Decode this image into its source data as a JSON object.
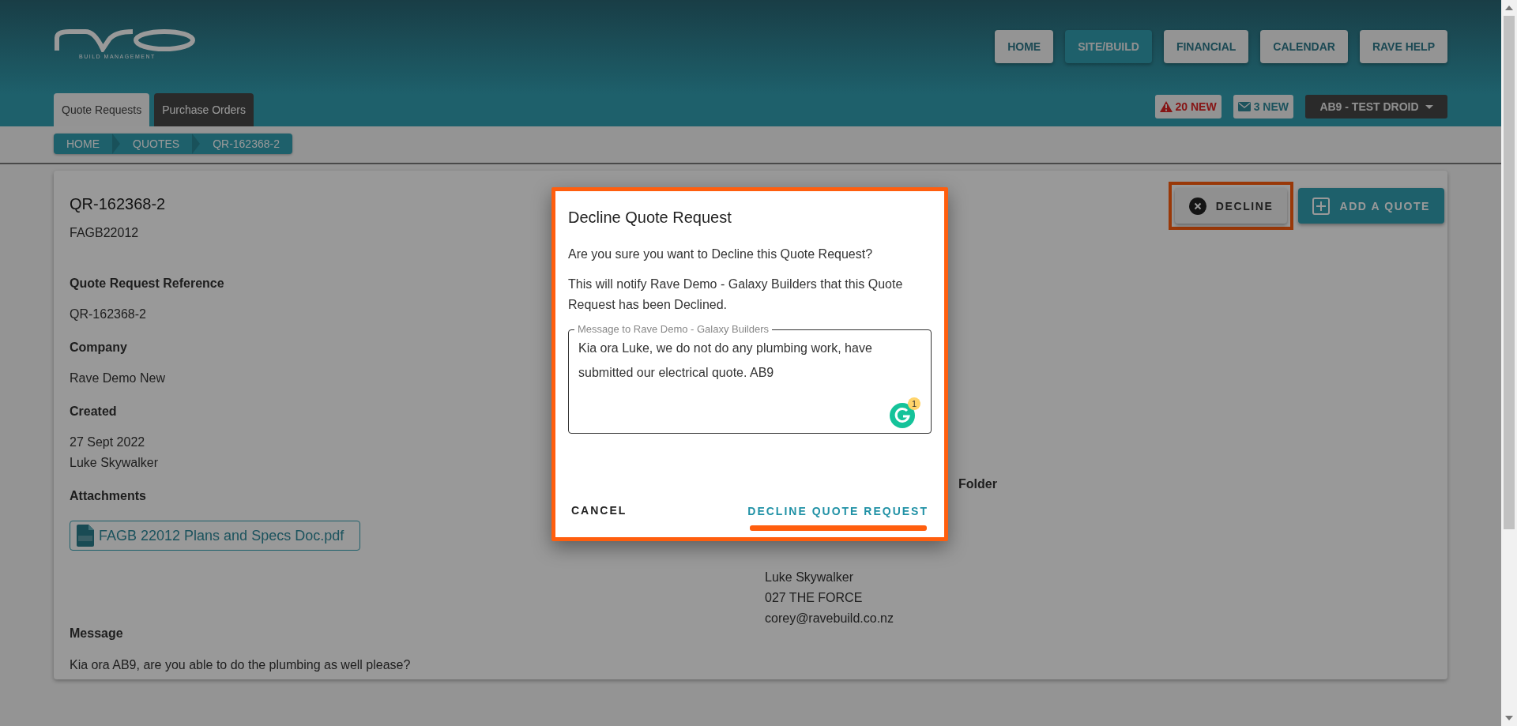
{
  "header": {
    "logo_tagline": "BUILD MANAGEMENT",
    "nav": [
      {
        "label": "HOME",
        "selected": false
      },
      {
        "label": "SITE/BUILD",
        "selected": true
      },
      {
        "label": "FINANCIAL",
        "selected": false
      },
      {
        "label": "CALENDAR",
        "selected": false
      },
      {
        "label": "RAVE HELP",
        "selected": false
      }
    ],
    "tabs": [
      {
        "label": "Quote Requests",
        "selected": true
      },
      {
        "label": "Purchase Orders",
        "selected": false
      }
    ],
    "alerts": [
      {
        "kind": "warning",
        "label": "20 NEW"
      },
      {
        "kind": "mail",
        "label": "3 NEW"
      }
    ],
    "user_menu": "AB9 - TEST DROID"
  },
  "breadcrumb": [
    "HOME",
    "QUOTES",
    "QR-162368-2"
  ],
  "quote": {
    "title": "QR-162368-2",
    "subtitle": "FAGB22012",
    "actions": [
      {
        "kind": "decline",
        "label": "DECLINE",
        "highlighted": true
      },
      {
        "kind": "add",
        "label": "ADD A QUOTE",
        "highlighted": false
      }
    ],
    "fields": [
      {
        "label": "Quote Request Reference",
        "lines": [
          "QR-162368-2"
        ]
      },
      {
        "label": "Company",
        "lines": [
          "Rave Demo New"
        ]
      },
      {
        "label": "Created",
        "lines": [
          "27 Sept 2022",
          "Luke Skywalker"
        ]
      }
    ],
    "attachments_label": "Attachments",
    "attachments": [
      "FAGB 22012 Plans and Specs Doc.pdf"
    ],
    "message_label": "Message",
    "message": "Kia ora AB9, are you able to do the plumbing as well please?",
    "side": {
      "heading": "Folder",
      "contact": [
        "Luke Skywalker",
        "027 THE FORCE",
        "corey@ravebuild.co.nz"
      ]
    }
  },
  "dialog": {
    "title": "Decline Quote Request",
    "highlighted": true,
    "paragraphs": [
      "Are you sure you want to Decline this Quote Request?",
      "This will notify Rave Demo - Galaxy Builders that this Quote Request has been Declined."
    ],
    "field": {
      "label": "Message to Rave Demo - Galaxy Builders",
      "value": "Kia ora Luke, we do not do any plumbing work, have submitted our electrical quote.  AB9"
    },
    "grammar_badge": "1",
    "cancel": "CANCEL",
    "confirm": "DECLINE QUOTE REQUEST",
    "confirm_highlighted": true
  }
}
